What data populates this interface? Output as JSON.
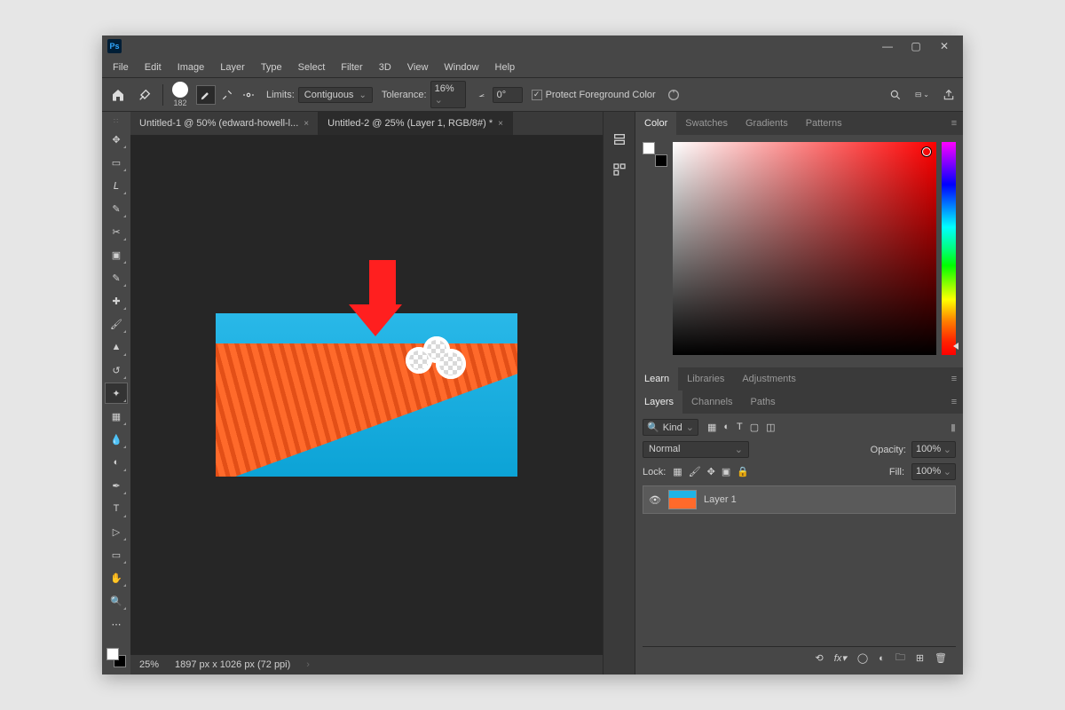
{
  "titlebar": {
    "badge": "Ps"
  },
  "menubar": [
    "File",
    "Edit",
    "Image",
    "Layer",
    "Type",
    "Select",
    "Filter",
    "3D",
    "View",
    "Window",
    "Help"
  ],
  "optionsbar": {
    "brush_size": "182",
    "limits_label": "Limits:",
    "limits_value": "Contiguous",
    "tolerance_label": "Tolerance:",
    "tolerance_value": "16%",
    "angle_value": "0°",
    "protect_fg_label": "Protect Foreground Color"
  },
  "tabs": [
    {
      "label": "Untitled-1 @ 50% (edward-howell-l...",
      "active": false
    },
    {
      "label": "Untitled-2 @ 25% (Layer 1, RGB/8#) *",
      "active": true
    }
  ],
  "status": {
    "zoom": "25%",
    "dims": "1897 px x 1026 px (72 ppi)"
  },
  "color_tabs": [
    "Color",
    "Swatches",
    "Gradients",
    "Patterns"
  ],
  "mid_tabs": [
    "Learn",
    "Libraries",
    "Adjustments"
  ],
  "layer_tabs": [
    "Layers",
    "Channels",
    "Paths"
  ],
  "layers": {
    "kind_label": "Kind",
    "blend_mode": "Normal",
    "opacity_label": "Opacity:",
    "opacity_value": "100%",
    "lock_label": "Lock:",
    "fill_label": "Fill:",
    "fill_value": "100%",
    "items": [
      {
        "name": "Layer 1"
      }
    ]
  },
  "tools": [
    {
      "name": "move-tool",
      "glyph": "✥"
    },
    {
      "name": "marquee-tool",
      "glyph": "▭"
    },
    {
      "name": "lasso-tool",
      "glyph": "𝘓"
    },
    {
      "name": "quick-select-tool",
      "glyph": "✎"
    },
    {
      "name": "crop-tool",
      "glyph": "✂"
    },
    {
      "name": "frame-tool",
      "glyph": "▣"
    },
    {
      "name": "eyedropper-tool",
      "glyph": "✎"
    },
    {
      "name": "healing-tool",
      "glyph": "✚"
    },
    {
      "name": "brush-tool",
      "glyph": "🖌"
    },
    {
      "name": "stamp-tool",
      "glyph": "▲"
    },
    {
      "name": "history-brush-tool",
      "glyph": "↺"
    },
    {
      "name": "background-eraser-tool",
      "glyph": "✦",
      "active": true
    },
    {
      "name": "gradient-tool",
      "glyph": "▦"
    },
    {
      "name": "blur-tool",
      "glyph": "💧"
    },
    {
      "name": "dodge-tool",
      "glyph": "◐"
    },
    {
      "name": "pen-tool",
      "glyph": "✒"
    },
    {
      "name": "type-tool",
      "glyph": "T"
    },
    {
      "name": "path-select-tool",
      "glyph": "▷"
    },
    {
      "name": "shape-tool",
      "glyph": "▭"
    },
    {
      "name": "hand-tool",
      "glyph": "✋"
    },
    {
      "name": "zoom-tool",
      "glyph": "🔍"
    }
  ]
}
